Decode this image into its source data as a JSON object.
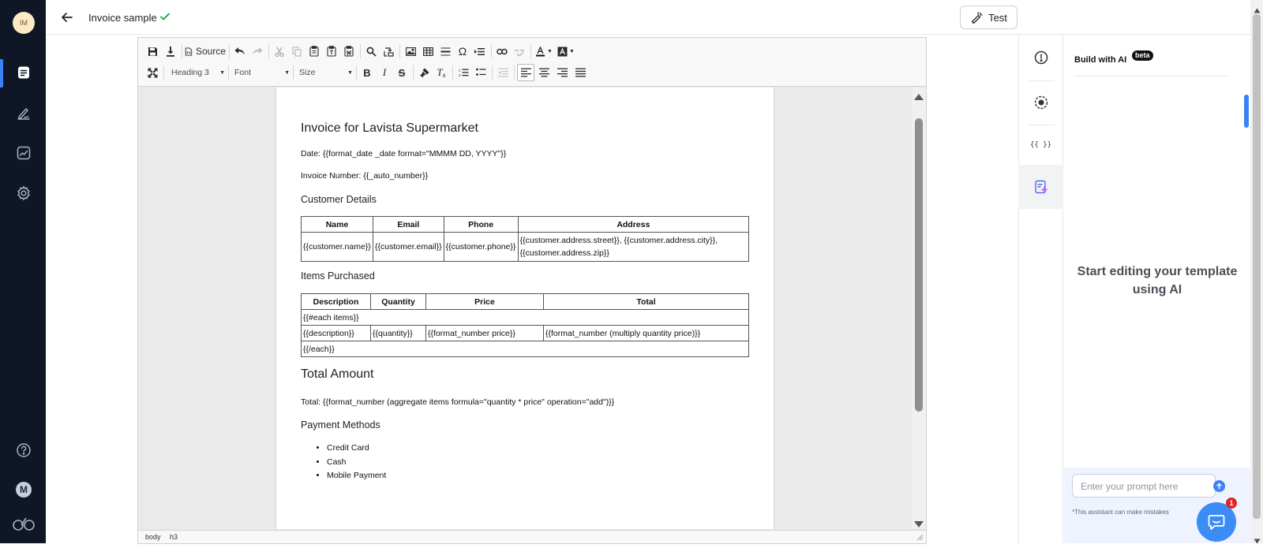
{
  "app": {
    "avatar_initials": "IM",
    "user_badge": "M",
    "doc_title": "Invoice sample",
    "test_label": "Test",
    "accent": "#3b82f6",
    "nav_bg": "#0f1726"
  },
  "toolbar": {
    "source_label": "Source",
    "format_combo": "Heading 3",
    "font_combo": "Font",
    "size_combo": "Size"
  },
  "statusbar": {
    "path": [
      "body",
      "h3"
    ]
  },
  "document": {
    "title": "Invoice for Lavista Supermarket",
    "date_line": "Date: {{format_date _date format=\"MMMM DD, YYYY\"}}",
    "invoice_line": "Invoice Number: {{_auto_number}}",
    "customer_heading": "Customer Details",
    "customer_table": {
      "headers": [
        "Name",
        "Email",
        "Phone",
        "Address"
      ],
      "row": [
        "{{customer.name}}",
        "{{customer.email}}",
        "{{customer.phone}}",
        "{{customer.address.street}}, {{customer.address.city}}, {{customer.address.zip}}"
      ]
    },
    "items_heading": "Items Purchased",
    "items_table": {
      "headers": [
        "Description",
        "Quantity",
        "Price",
        "Total"
      ],
      "each_open": "{{#each items}}",
      "row": [
        "{{description}}",
        "{{quantity}}",
        "{{format_number price}}",
        "{{format_number (multiply quantity price)}}"
      ],
      "each_close": "{{/each}}"
    },
    "total_heading": "Total Amount",
    "total_line": "Total: {{format_number (aggregate items formula=\"quantity * price\" operation=\"add\")}}",
    "payment_heading": "Payment Methods",
    "payment_methods": [
      "Credit Card",
      "Cash",
      "Mobile Payment"
    ]
  },
  "ai_panel": {
    "title": "Build with AI",
    "badge": "beta",
    "empty_message": "Start editing your template using AI",
    "prompt_placeholder": "Enter your prompt here",
    "disclaimer": "*This assistant can make mistakes",
    "chat_notification_count": "1"
  },
  "side_tabs": {
    "variables_glyph": "{{ }}"
  }
}
